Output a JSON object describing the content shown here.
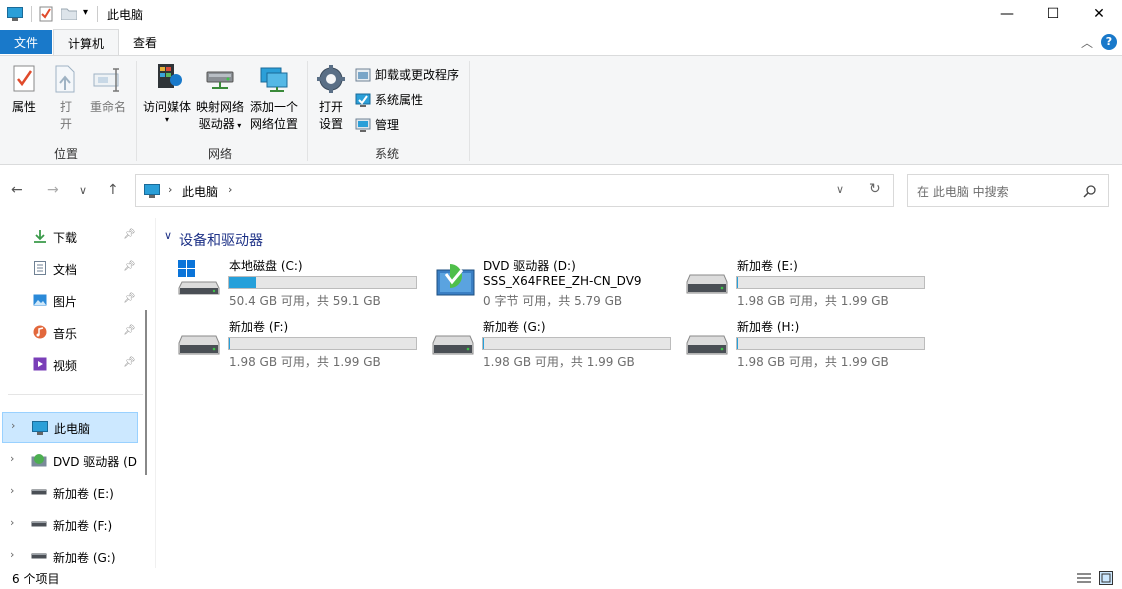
{
  "window": {
    "title": "此电脑",
    "minimize": "—",
    "maximize": "☐",
    "close": "✕"
  },
  "ribbon_tabs": [
    "文件",
    "计算机",
    "查看"
  ],
  "ribbon": {
    "location_group": "位置",
    "network_group": "网络",
    "system_group": "系统",
    "properties": "属性",
    "open": "打\n开",
    "rename": "重命名",
    "access_media": "访问媒体",
    "map_drive_1": "映射网络",
    "map_drive_2": "驱动器",
    "add_location_1": "添加一个",
    "add_location_2": "网络位置",
    "open_settings_1": "打开",
    "open_settings_2": "设置",
    "uninstall": "卸载或更改程序",
    "system_properties": "系统属性",
    "manage": "管理"
  },
  "address": {
    "path": "此电脑",
    "search_placeholder": "在 此电脑 中搜索"
  },
  "quick_access": [
    {
      "label": "下载",
      "icon": "download-icon"
    },
    {
      "label": "文档",
      "icon": "document-icon"
    },
    {
      "label": "图片",
      "icon": "picture-icon"
    },
    {
      "label": "音乐",
      "icon": "music-icon"
    },
    {
      "label": "视频",
      "icon": "video-icon"
    }
  ],
  "tree": [
    {
      "label": "此电脑",
      "icon": "pc-icon"
    },
    {
      "label": "DVD 驱动器 (D",
      "icon": "dvd-icon"
    },
    {
      "label": "新加卷 (E:)",
      "icon": "drive-icon"
    },
    {
      "label": "新加卷 (F:)",
      "icon": "drive-icon"
    },
    {
      "label": "新加卷 (G:)",
      "icon": "drive-icon"
    }
  ],
  "section_title": "设备和驱动器",
  "drives": [
    {
      "name": "本地磁盘 (C:)",
      "space": "50.4 GB 可用，共 59.1 GB",
      "used_fraction": 0.147,
      "type": "system"
    },
    {
      "name": "DVD 驱动器 (D:)",
      "name2": "SSS_X64FREE_ZH-CN_DV9",
      "space": "0 字节 可用，共 5.79 GB",
      "type": "dvd"
    },
    {
      "name": "新加卷 (E:)",
      "space": "1.98 GB 可用，共 1.99 GB",
      "used_fraction": 0.005,
      "type": "hdd"
    },
    {
      "name": "新加卷 (F:)",
      "space": "1.98 GB 可用，共 1.99 GB",
      "used_fraction": 0.005,
      "type": "hdd"
    },
    {
      "name": "新加卷 (G:)",
      "space": "1.98 GB 可用，共 1.99 GB",
      "used_fraction": 0.005,
      "type": "hdd"
    },
    {
      "name": "新加卷 (H:)",
      "space": "1.98 GB 可用，共 1.99 GB",
      "used_fraction": 0.005,
      "type": "hdd"
    }
  ],
  "status": {
    "items": "6 个项目"
  },
  "colors": {
    "accent": "#0063b1",
    "selection": "#cce8ff",
    "bar_fill": "#26a0da"
  }
}
